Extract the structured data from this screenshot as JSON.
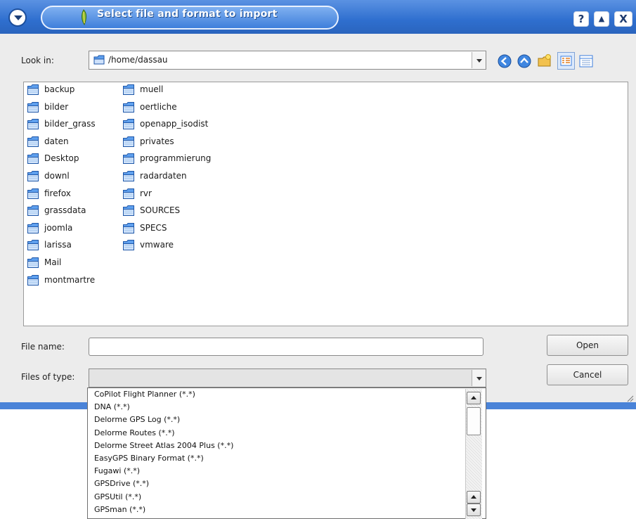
{
  "titlebar": {
    "title": "Select file and format to import",
    "help_glyph": "?",
    "shade_glyph": "▲",
    "close_glyph": "X"
  },
  "lookin": {
    "label": "Look in:",
    "path": "/home/dassau"
  },
  "nav_icons": [
    "back-icon",
    "up-icon",
    "new-folder-icon",
    "list-view-icon",
    "detail-view-icon"
  ],
  "folders_col1": [
    "backup",
    "bilder",
    "bilder_grass",
    "daten",
    "Desktop",
    "downl",
    "firefox",
    "grassdata",
    "joomla",
    "larissa",
    "Mail",
    "montmartre"
  ],
  "folders_col2": [
    "muell",
    "oertliche",
    "openapp_isodist",
    "privates",
    "programmierung",
    "radardaten",
    "rvr",
    "SOURCES",
    "SPECS",
    "vmware"
  ],
  "filename": {
    "label": "File name:",
    "value": ""
  },
  "filetype": {
    "label": "Files of type:",
    "value": ""
  },
  "buttons": {
    "open": "Open",
    "cancel": "Cancel"
  },
  "filetype_options": [
    "CoPilot Flight Planner (*.*)",
    "DNA (*.*)",
    "Delorme GPS Log (*.*)",
    "Delorme Routes (*.*)",
    "Delorme Street Atlas 2004 Plus (*.*)",
    "EasyGPS Binary Format (*.*)",
    "Fugawi (*.*)",
    "GPSDrive (*.*)",
    "GPSUtil (*.*)",
    "GPSman (*.*)"
  ],
  "colors": {
    "titlebar": "#2f6fcf",
    "folder": "#3b7ddd",
    "window_bg": "#ececec"
  }
}
